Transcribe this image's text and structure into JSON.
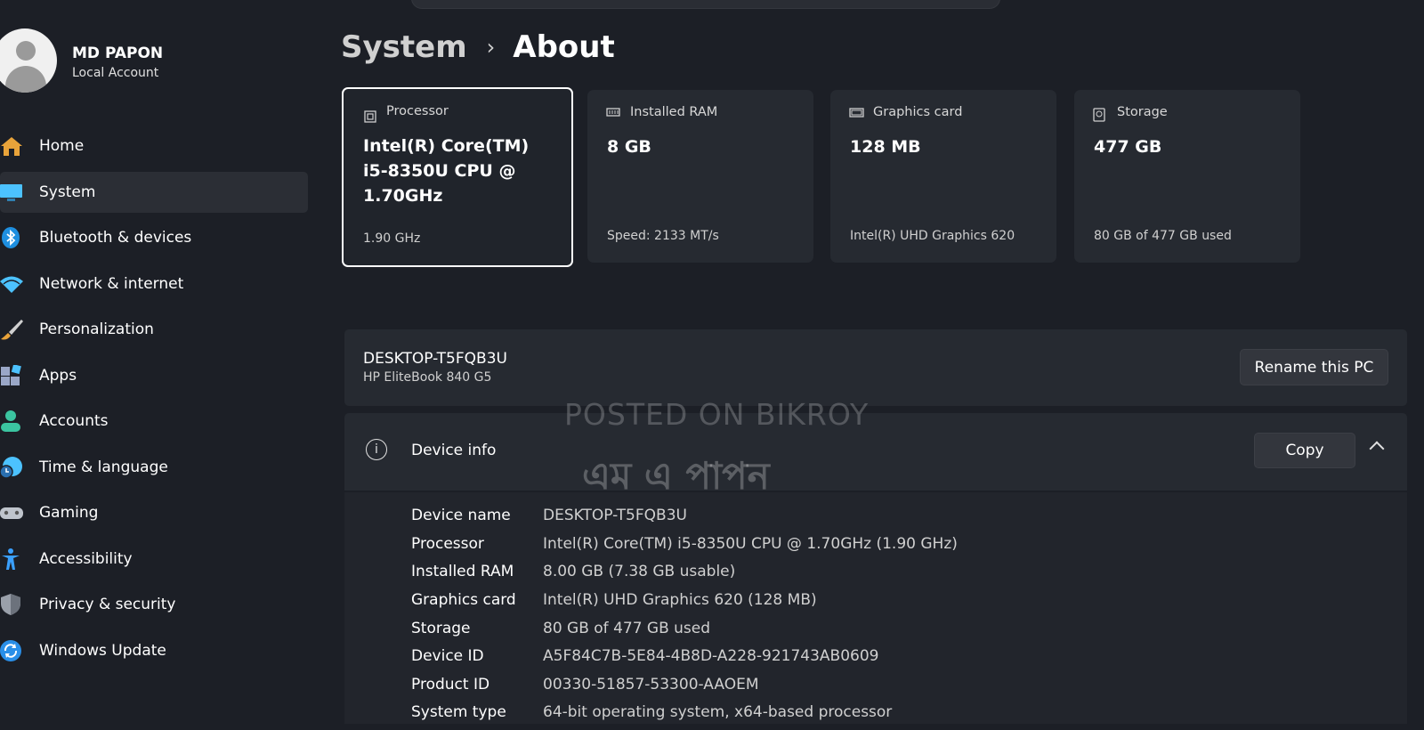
{
  "profile": {
    "name": "MD PAPON",
    "account": "Local Account"
  },
  "nav": {
    "items": [
      {
        "label": "Home",
        "icon": "home-icon",
        "color": "#e8a33a"
      },
      {
        "label": "System",
        "icon": "monitor-icon",
        "color": "#4cc2ff"
      },
      {
        "label": "Bluetooth & devices",
        "icon": "bluetooth-icon",
        "color": "#1e8fe0"
      },
      {
        "label": "Network & internet",
        "icon": "wifi-icon",
        "color": "#4cc2ff"
      },
      {
        "label": "Personalization",
        "icon": "brush-icon",
        "color": "#e8a33a"
      },
      {
        "label": "Apps",
        "icon": "apps-icon",
        "color": "#9aa7c7"
      },
      {
        "label": "Accounts",
        "icon": "person-icon",
        "color": "#3bc4a0"
      },
      {
        "label": "Time & language",
        "icon": "globe-clock-icon",
        "color": "#4cc2ff"
      },
      {
        "label": "Gaming",
        "icon": "gamepad-icon",
        "color": "#bfc4cc"
      },
      {
        "label": "Accessibility",
        "icon": "accessibility-icon",
        "color": "#3aa0ff"
      },
      {
        "label": "Privacy & security",
        "icon": "shield-icon",
        "color": "#9aa0aa"
      },
      {
        "label": "Windows Update",
        "icon": "update-icon",
        "color": "#2a8fe8"
      }
    ],
    "active": "System"
  },
  "breadcrumb": {
    "parent": "System",
    "separator": "›",
    "current": "About"
  },
  "cards": [
    {
      "label": "Processor",
      "value": "Intel(R) Core(TM) i5-8350U CPU @ 1.70GHz",
      "sub": "1.90 GHz",
      "icon": "cpu-icon"
    },
    {
      "label": "Installed RAM",
      "value": "8 GB",
      "sub": "Speed: 2133 MT/s",
      "icon": "ram-icon"
    },
    {
      "label": "Graphics card",
      "value": "128 MB",
      "sub": "Intel(R) UHD Graphics 620",
      "icon": "gpu-icon"
    },
    {
      "label": "Storage",
      "value": "477 GB",
      "sub": "80 GB of 477 GB used",
      "icon": "storage-icon"
    }
  ],
  "pc": {
    "name": "DESKTOP-T5FQB3U",
    "model": "HP EliteBook 840 G5",
    "rename_label": "Rename this PC"
  },
  "device_info": {
    "title": "Device info",
    "copy_label": "Copy",
    "rows": [
      {
        "key": "Device name",
        "value": "DESKTOP-T5FQB3U"
      },
      {
        "key": "Processor",
        "value": "Intel(R) Core(TM) i5-8350U CPU @ 1.70GHz (1.90 GHz)"
      },
      {
        "key": "Installed RAM",
        "value": "8.00 GB (7.38 GB usable)"
      },
      {
        "key": "Graphics card",
        "value": "Intel(R) UHD Graphics 620 (128 MB)"
      },
      {
        "key": "Storage",
        "value": "80 GB of 477 GB used"
      },
      {
        "key": "Device ID",
        "value": "A5F84C7B-5E84-4B8D-A228-921743AB0609"
      },
      {
        "key": "Product ID",
        "value": "00330-51857-53300-AAOEM"
      },
      {
        "key": "System type",
        "value": "64-bit operating system, x64-based processor"
      }
    ]
  },
  "watermark": {
    "line1": "POSTED ON BIKROY",
    "line2": "এম এ পাপন"
  }
}
